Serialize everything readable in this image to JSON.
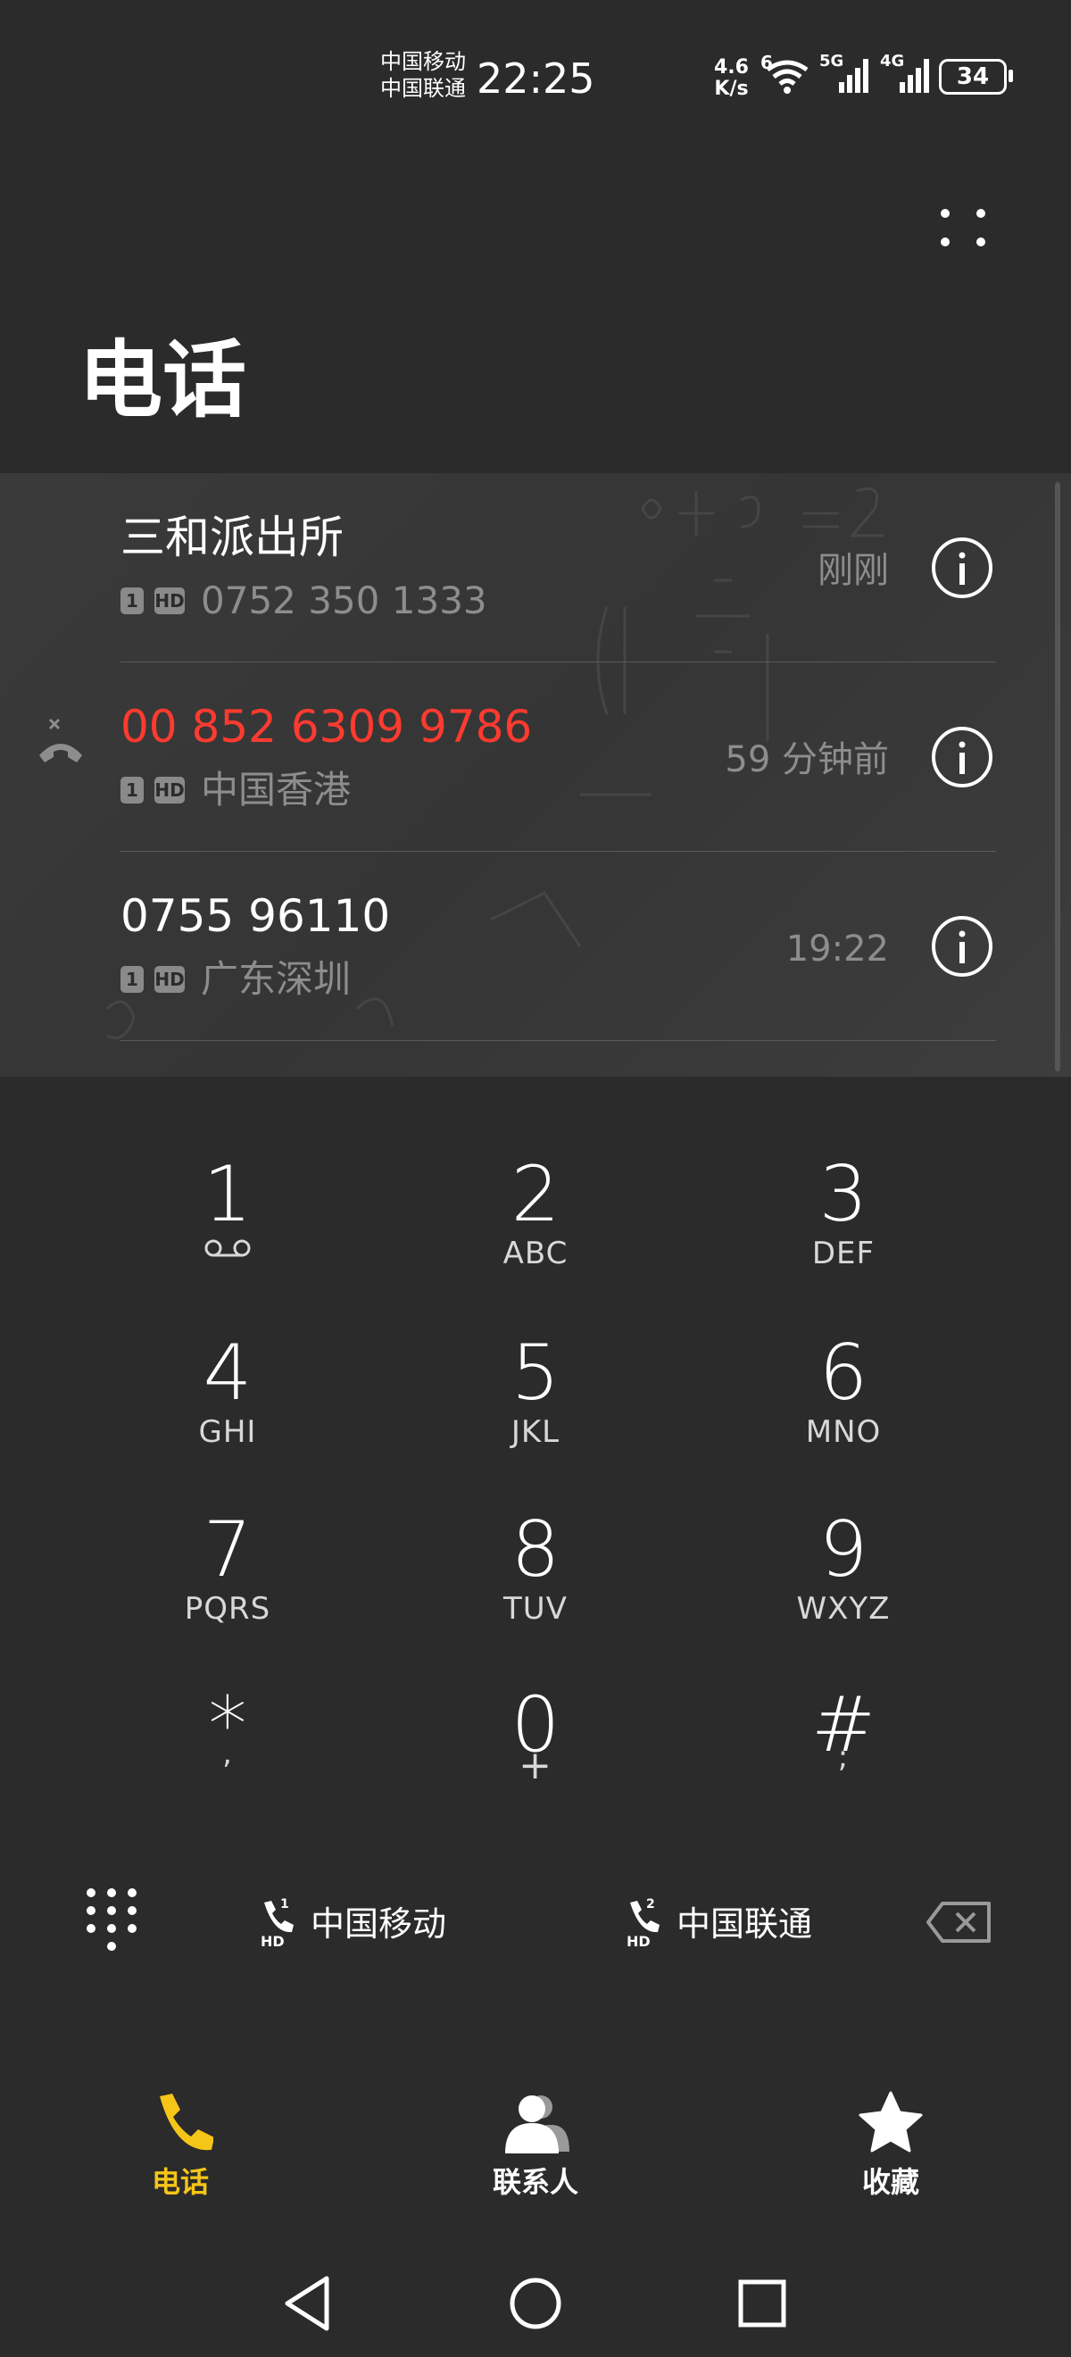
{
  "status_bar": {
    "carrier_1": "中国移动",
    "carrier_2": "中国联通",
    "time": "22:25",
    "net_speed_value": "4.6",
    "net_speed_unit": "K/s",
    "wifi_label": "6",
    "sim1_network": "5G",
    "sim2_network": "4G",
    "battery": "34"
  },
  "header": {
    "title": "电话"
  },
  "call_log": [
    {
      "name": "三和派出所",
      "sim": "1",
      "hd": "HD",
      "location": "0752 350 1333",
      "time": "刚刚",
      "missed": false
    },
    {
      "name": "00 852 6309 9786",
      "sim": "1",
      "hd": "HD",
      "location": "中国香港",
      "time": "59 分钟前",
      "missed": true
    },
    {
      "name": "0755 96110",
      "sim": "1",
      "hd": "HD",
      "location": "广东深圳",
      "time": "19:22",
      "missed": false
    }
  ],
  "dialpad": {
    "keys": [
      {
        "digit": "1",
        "letters": ""
      },
      {
        "digit": "2",
        "letters": "ABC"
      },
      {
        "digit": "3",
        "letters": "DEF"
      },
      {
        "digit": "4",
        "letters": "GHI"
      },
      {
        "digit": "5",
        "letters": "JKL"
      },
      {
        "digit": "6",
        "letters": "MNO"
      },
      {
        "digit": "7",
        "letters": "PQRS"
      },
      {
        "digit": "8",
        "letters": "TUV"
      },
      {
        "digit": "9",
        "letters": "WXYZ"
      },
      {
        "digit": "*",
        "letters": ","
      },
      {
        "digit": "0",
        "letters": "+"
      },
      {
        "digit": "#",
        "letters": ";"
      }
    ]
  },
  "actions": {
    "sim1_call": {
      "label": "中国移动",
      "sim_number": "1",
      "hd": "HD"
    },
    "sim2_call": {
      "label": "中国联通",
      "sim_number": "2",
      "hd": "HD"
    }
  },
  "tabs": [
    {
      "label": "电话",
      "active": true
    },
    {
      "label": "联系人",
      "active": false
    },
    {
      "label": "收藏",
      "active": false
    }
  ],
  "colors": {
    "background": "#2b2b2b",
    "accent": "#f5c518",
    "missed": "#ff3b30",
    "secondary_text": "#8d8d8d"
  }
}
